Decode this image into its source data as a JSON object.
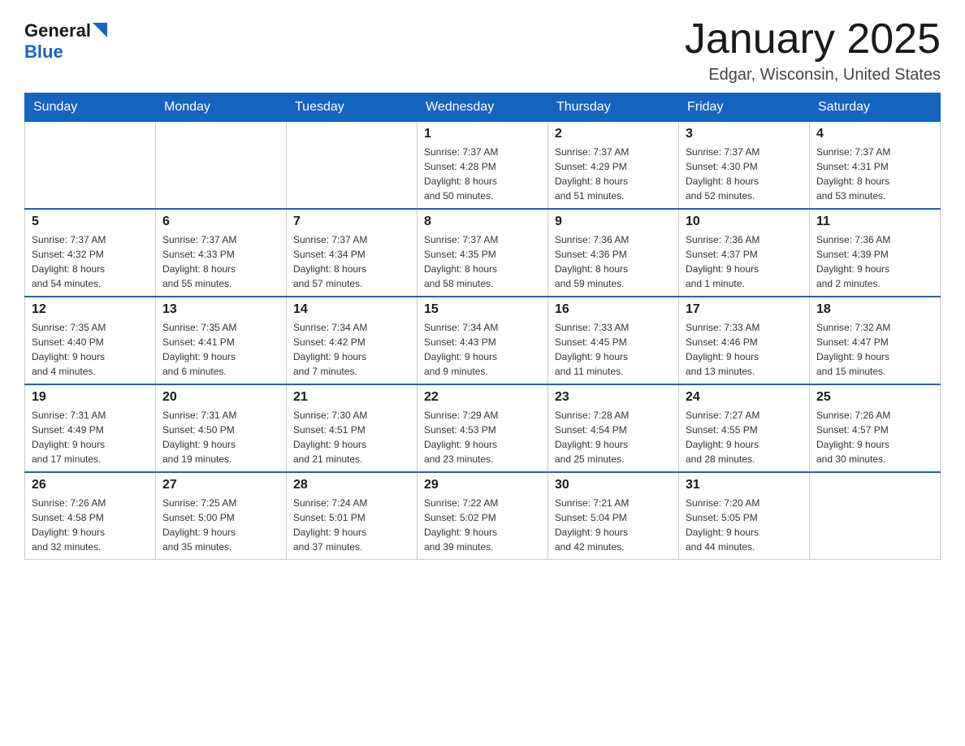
{
  "header": {
    "logo": {
      "general": "General",
      "blue": "Blue"
    },
    "title": "January 2025",
    "location": "Edgar, Wisconsin, United States"
  },
  "weekdays": [
    "Sunday",
    "Monday",
    "Tuesday",
    "Wednesday",
    "Thursday",
    "Friday",
    "Saturday"
  ],
  "weeks": [
    [
      {
        "day": "",
        "info": ""
      },
      {
        "day": "",
        "info": ""
      },
      {
        "day": "",
        "info": ""
      },
      {
        "day": "1",
        "info": "Sunrise: 7:37 AM\nSunset: 4:28 PM\nDaylight: 8 hours\nand 50 minutes."
      },
      {
        "day": "2",
        "info": "Sunrise: 7:37 AM\nSunset: 4:29 PM\nDaylight: 8 hours\nand 51 minutes."
      },
      {
        "day": "3",
        "info": "Sunrise: 7:37 AM\nSunset: 4:30 PM\nDaylight: 8 hours\nand 52 minutes."
      },
      {
        "day": "4",
        "info": "Sunrise: 7:37 AM\nSunset: 4:31 PM\nDaylight: 8 hours\nand 53 minutes."
      }
    ],
    [
      {
        "day": "5",
        "info": "Sunrise: 7:37 AM\nSunset: 4:32 PM\nDaylight: 8 hours\nand 54 minutes."
      },
      {
        "day": "6",
        "info": "Sunrise: 7:37 AM\nSunset: 4:33 PM\nDaylight: 8 hours\nand 55 minutes."
      },
      {
        "day": "7",
        "info": "Sunrise: 7:37 AM\nSunset: 4:34 PM\nDaylight: 8 hours\nand 57 minutes."
      },
      {
        "day": "8",
        "info": "Sunrise: 7:37 AM\nSunset: 4:35 PM\nDaylight: 8 hours\nand 58 minutes."
      },
      {
        "day": "9",
        "info": "Sunrise: 7:36 AM\nSunset: 4:36 PM\nDaylight: 8 hours\nand 59 minutes."
      },
      {
        "day": "10",
        "info": "Sunrise: 7:36 AM\nSunset: 4:37 PM\nDaylight: 9 hours\nand 1 minute."
      },
      {
        "day": "11",
        "info": "Sunrise: 7:36 AM\nSunset: 4:39 PM\nDaylight: 9 hours\nand 2 minutes."
      }
    ],
    [
      {
        "day": "12",
        "info": "Sunrise: 7:35 AM\nSunset: 4:40 PM\nDaylight: 9 hours\nand 4 minutes."
      },
      {
        "day": "13",
        "info": "Sunrise: 7:35 AM\nSunset: 4:41 PM\nDaylight: 9 hours\nand 6 minutes."
      },
      {
        "day": "14",
        "info": "Sunrise: 7:34 AM\nSunset: 4:42 PM\nDaylight: 9 hours\nand 7 minutes."
      },
      {
        "day": "15",
        "info": "Sunrise: 7:34 AM\nSunset: 4:43 PM\nDaylight: 9 hours\nand 9 minutes."
      },
      {
        "day": "16",
        "info": "Sunrise: 7:33 AM\nSunset: 4:45 PM\nDaylight: 9 hours\nand 11 minutes."
      },
      {
        "day": "17",
        "info": "Sunrise: 7:33 AM\nSunset: 4:46 PM\nDaylight: 9 hours\nand 13 minutes."
      },
      {
        "day": "18",
        "info": "Sunrise: 7:32 AM\nSunset: 4:47 PM\nDaylight: 9 hours\nand 15 minutes."
      }
    ],
    [
      {
        "day": "19",
        "info": "Sunrise: 7:31 AM\nSunset: 4:49 PM\nDaylight: 9 hours\nand 17 minutes."
      },
      {
        "day": "20",
        "info": "Sunrise: 7:31 AM\nSunset: 4:50 PM\nDaylight: 9 hours\nand 19 minutes."
      },
      {
        "day": "21",
        "info": "Sunrise: 7:30 AM\nSunset: 4:51 PM\nDaylight: 9 hours\nand 21 minutes."
      },
      {
        "day": "22",
        "info": "Sunrise: 7:29 AM\nSunset: 4:53 PM\nDaylight: 9 hours\nand 23 minutes."
      },
      {
        "day": "23",
        "info": "Sunrise: 7:28 AM\nSunset: 4:54 PM\nDaylight: 9 hours\nand 25 minutes."
      },
      {
        "day": "24",
        "info": "Sunrise: 7:27 AM\nSunset: 4:55 PM\nDaylight: 9 hours\nand 28 minutes."
      },
      {
        "day": "25",
        "info": "Sunrise: 7:26 AM\nSunset: 4:57 PM\nDaylight: 9 hours\nand 30 minutes."
      }
    ],
    [
      {
        "day": "26",
        "info": "Sunrise: 7:26 AM\nSunset: 4:58 PM\nDaylight: 9 hours\nand 32 minutes."
      },
      {
        "day": "27",
        "info": "Sunrise: 7:25 AM\nSunset: 5:00 PM\nDaylight: 9 hours\nand 35 minutes."
      },
      {
        "day": "28",
        "info": "Sunrise: 7:24 AM\nSunset: 5:01 PM\nDaylight: 9 hours\nand 37 minutes."
      },
      {
        "day": "29",
        "info": "Sunrise: 7:22 AM\nSunset: 5:02 PM\nDaylight: 9 hours\nand 39 minutes."
      },
      {
        "day": "30",
        "info": "Sunrise: 7:21 AM\nSunset: 5:04 PM\nDaylight: 9 hours\nand 42 minutes."
      },
      {
        "day": "31",
        "info": "Sunrise: 7:20 AM\nSunset: 5:05 PM\nDaylight: 9 hours\nand 44 minutes."
      },
      {
        "day": "",
        "info": ""
      }
    ]
  ]
}
